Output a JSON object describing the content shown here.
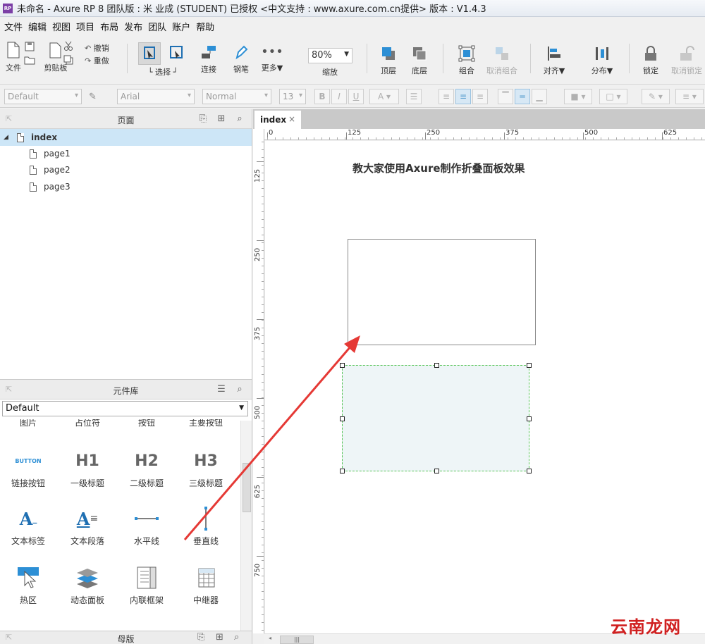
{
  "window": {
    "title": "未命名 - Axure RP 8 团队版 : 米 业成 (STUDENT) 已授权      <中文支持 : www.axure.com.cn提供> 版本 : V1.4.3",
    "app_icon": "RP"
  },
  "menubar": [
    "文件",
    "编辑",
    "视图",
    "项目",
    "布局",
    "发布",
    "团队",
    "账户",
    "帮助"
  ],
  "toolbar": {
    "file": "文件",
    "clipboard": "剪贴板",
    "undo": "撤销",
    "redo": "重做",
    "select": "选择",
    "connect": "连接",
    "pen": "钢笔",
    "more": "更多▼",
    "zoom_value": "80%",
    "zoom_label": "缩放",
    "top_layer": "顶层",
    "bottom_layer": "底层",
    "group": "组合",
    "ungroup": "取消组合",
    "align": "对齐▼",
    "distribute": "分布▼",
    "lock": "锁定",
    "unlock": "取消锁定"
  },
  "formatbar": {
    "style": "Default",
    "font": "Arial",
    "weight": "Normal",
    "size": "13",
    "bold": "B",
    "italic": "I",
    "underline": "U",
    "font_color": "A"
  },
  "pages_panel": {
    "title": "页面",
    "root": "index",
    "children": [
      "page1",
      "page2",
      "page3"
    ]
  },
  "widgets_panel": {
    "title": "元件库",
    "library": "Default",
    "partial_row": [
      "图片",
      "占位符",
      "按钮",
      "主要按钮"
    ],
    "items": [
      {
        "label": "链接按钮",
        "glyph": "BUTTON",
        "icon": "link-button-icon"
      },
      {
        "label": "一级标题",
        "glyph": "H1",
        "icon": "h1-icon"
      },
      {
        "label": "二级标题",
        "glyph": "H2",
        "icon": "h2-icon"
      },
      {
        "label": "三级标题",
        "glyph": "H3",
        "icon": "h3-icon"
      },
      {
        "label": "文本标签",
        "glyph": "A",
        "icon": "text-label-icon"
      },
      {
        "label": "文本段落",
        "glyph": "A",
        "icon": "paragraph-icon"
      },
      {
        "label": "水平线",
        "glyph": "",
        "icon": "horizontal-line-icon"
      },
      {
        "label": "垂直线",
        "glyph": "",
        "icon": "vertical-line-icon"
      },
      {
        "label": "热区",
        "glyph": "",
        "icon": "hotspot-icon"
      },
      {
        "label": "动态面板",
        "glyph": "",
        "icon": "dynamic-panel-icon"
      },
      {
        "label": "内联框架",
        "glyph": "",
        "icon": "inline-frame-icon"
      },
      {
        "label": "中继器",
        "glyph": "",
        "icon": "repeater-icon"
      }
    ]
  },
  "masters_panel": {
    "title": "母版"
  },
  "canvas": {
    "tab": "index",
    "tab_close": "×",
    "ruler_h": [
      "0",
      "125",
      "250",
      "375",
      "500",
      "625"
    ],
    "ruler_v": [
      "125",
      "250",
      "375",
      "500",
      "625",
      "750"
    ],
    "heading": "教大家使用Axure制作折叠面板效果"
  },
  "watermark": "云南龙网",
  "colors": {
    "selection": "#cde6f7",
    "accent_blue": "#2d8fd5",
    "arrow": "#e53935",
    "panel_dash": "#55c455"
  }
}
